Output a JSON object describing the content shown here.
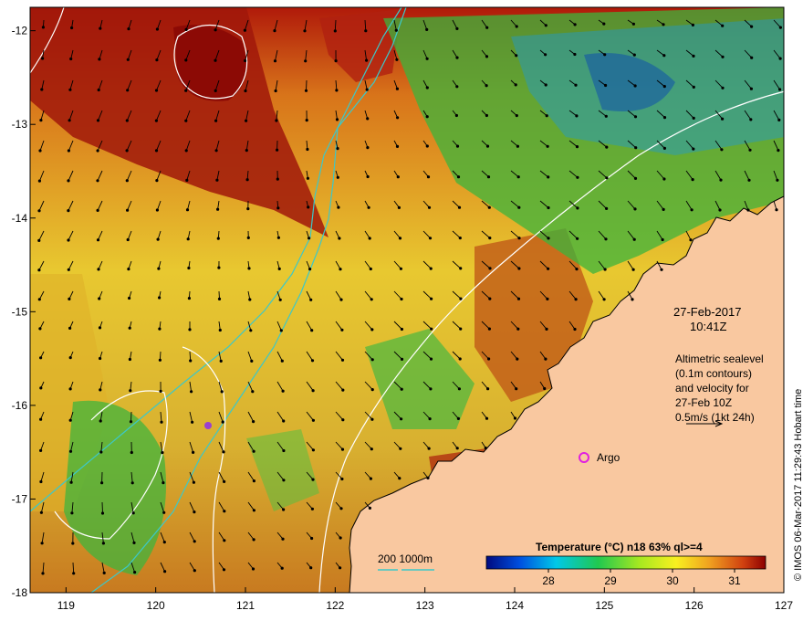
{
  "map": {
    "x_ticks": [
      "119",
      "120",
      "121",
      "122",
      "123",
      "124",
      "125",
      "126",
      "127"
    ],
    "y_ticks": [
      "-12",
      "-13",
      "-14",
      "-15",
      "-16",
      "-17",
      "-18"
    ],
    "lon_range": [
      118.6,
      127.0
    ],
    "lat_range": [
      -18.0,
      -11.75
    ],
    "colors": {
      "land": "#f9c8a0",
      "depth_contour": "#3cc8c8",
      "sealevel_contour": "#ffffff",
      "argo_marker": "#e020e0"
    }
  },
  "annotations": {
    "date": "27-Feb-2017",
    "time": "10:41Z",
    "legend_line1": "Altimetric sealevel",
    "legend_line2": "(0.1m contours)",
    "legend_line3": "and velocity for",
    "legend_line4": "27-Feb 10Z",
    "legend_line5": "0.5m/s (1kt 24h)",
    "argo_label": "Argo",
    "depth_label": "200  1000m",
    "credit": "© IMOS 06-Mar-2017 11:29:43 Hobart time"
  },
  "colorbar": {
    "title": "Temperature (°C) n18 63% ql>=4",
    "ticks": [
      "28",
      "29",
      "30",
      "31"
    ],
    "range": [
      27.0,
      31.5
    ]
  }
}
